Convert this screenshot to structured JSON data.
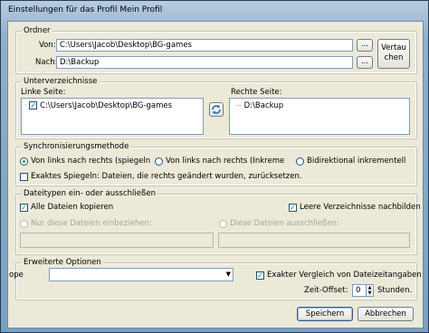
{
  "window": {
    "title": "Einstellungen für das Profil Mein Profil"
  },
  "ordner": {
    "legend": "Ordner",
    "von_label": "Von:",
    "von_value": "C:\\Users\\Jacob\\Desktop\\BG-games",
    "nach_label": "Nach:",
    "nach_value": "D:\\Backup",
    "browse_label": "...",
    "swap_label_1": "Vertau",
    "swap_label_2": "chen"
  },
  "unterverzeichnisse": {
    "legend": "Unterverzeichnisse",
    "left_label": "Linke Seite:",
    "right_label": "Rechte Seite:",
    "left_item": "C:\\Users\\Jacob\\Desktop\\BG-games",
    "right_item": "D:\\Backup"
  },
  "sync": {
    "legend": "Synchronisierungsmethode",
    "options": [
      "Von links nach rechts (spiegeln",
      "Von links nach rechts (Inkreme",
      "Bidirektional inkrementell"
    ],
    "selected_index": 0,
    "exact_label": "Exaktes Spiegeln: Dateien, die rechts geändert wurden, zurücksetzen."
  },
  "dateitypen": {
    "legend": "Dateitypen ein- oder ausschließen",
    "all_files": "Alle Dateien kopieren",
    "empty_dirs": "Leere Verzeichnisse nachbilden",
    "include_only": "Nur diese Dateien einbeziehen:",
    "exclude": "Diese Dateien ausschließen:"
  },
  "erweitert": {
    "legend": "Erweiterte Optionen",
    "type_label": "ope",
    "exact_compare": "Exakter Vergleich von Dateizeitangaben",
    "offset_label": "Zeit-Offset:",
    "offset_value": "0",
    "hours_label": "Stunden."
  },
  "buttons": {
    "save": "Speichern",
    "cancel": "Abbrechen"
  },
  "colors": {
    "accent": "#2aa22a",
    "field_border": "#7f9db9"
  }
}
